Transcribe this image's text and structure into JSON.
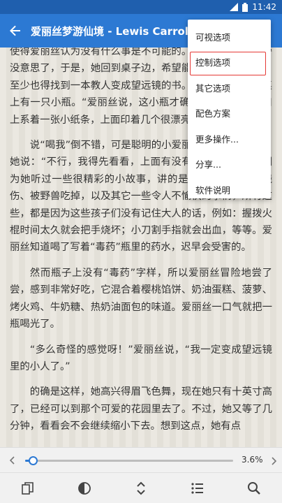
{
  "status_bar": {
    "time": "11:42",
    "icons": [
      "signal-icon",
      "battery-icon"
    ]
  },
  "toolbar": {
    "title": "爱丽丝梦游仙境 - Lewis Carroll"
  },
  "menu": {
    "items": [
      {
        "label": "可视选项"
      },
      {
        "label": "控制选项",
        "highlighted": true
      },
      {
        "label": "其它选项"
      },
      {
        "label": "配色方案"
      },
      {
        "label": "更多操作..."
      },
      {
        "label": "分享..."
      },
      {
        "label": "软件说明"
      }
    ]
  },
  "content": {
    "paragraphs": [
      "使得爱丽丝认为没有什么事是不可能的。她觉得在这小门旁没意思了，于是，她回到桌子边，希望能找到另一把钥匙，至少也得找到一本教人变成望远镜的书。可这次，她发现桌上有一只小瓶。“爱丽丝说，这小瓶才确实不在这里。”瓶口上系着一张小纸条，上面印着几个很漂亮的大字：“喝我”。",
      "说“喝我”倒不错，可是聪明的小爱丽丝可不忙着去喝。她说：“不行，我得先看看，上面有没有‘毒药’两个字。”因为她听过一些很精彩的小故事，讲的是一些孩子怎样被烧伤、被野兽吃掉，以及其它一些令人不愉快的事情，所有这些，都是因为这些孩子们没有记住大人的话，例如：握拨火棍时间太久就会把手烧坏；小刀割手指就会出血，等等。爱丽丝知道喝了写着“毒药”瓶里的药水，迟早会受害的。",
      "然而瓶子上没有“毒药”字样，所以爱丽丝冒险地尝了尝，感到非常好吃，它混合着樱桃馅饼、奶油蛋糕、菠萝、烤火鸡、牛奶糖、热奶油面包的味道。爱丽丝一口气就把一瓶喝光了。",
      "“多么奇怪的感觉呀！”爱丽丝说，“我一定变成望远镜里的小人了。”",
      "的确是这样，她高兴得眉飞色舞，现在她只有十英寸高了，已经可以到那个可爱的花园里去了。不过，她又等了几分钟，看看会不会继续缩小下去。想到这点，她有点"
    ]
  },
  "progress": {
    "percent_label": "3.6%",
    "fraction": 0.036
  },
  "bottom_bar": {
    "buttons": [
      "bookmarks-icon",
      "color-mode-icon",
      "page-scroll-icon",
      "toc-list-icon",
      "search-icon"
    ]
  },
  "colors": {
    "accent": "#2c79d3",
    "status_bar": "#1f5fae",
    "highlight_box": "#e53935"
  }
}
